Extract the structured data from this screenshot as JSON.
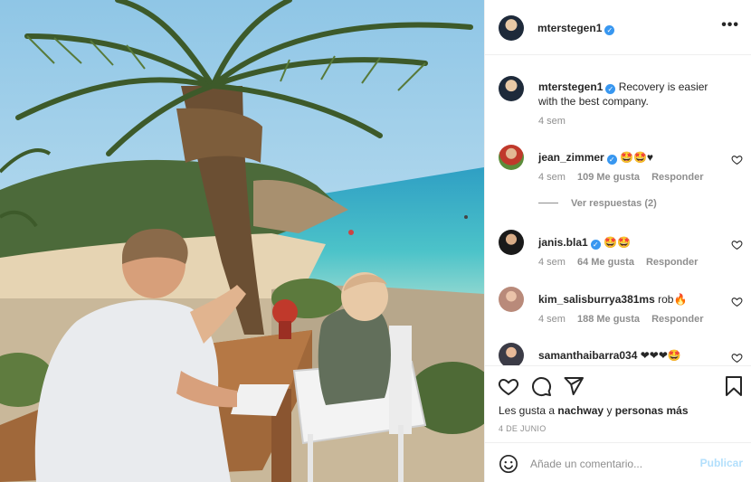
{
  "post": {
    "author": "mterstegen1",
    "caption": "Recovery is easier with the best company.",
    "caption_time": "4 sem",
    "more_label": "•••"
  },
  "comments": [
    {
      "user": "jean_zimmer",
      "verified": true,
      "text": "🤩🤩♥",
      "time": "4 sem",
      "likes": "109 Me gusta",
      "reply": "Responder",
      "view_replies": "Ver respuestas (2)"
    },
    {
      "user": "janis.bla1",
      "verified": true,
      "text": "🤩🤩",
      "time": "4 sem",
      "likes": "64 Me gusta",
      "reply": "Responder"
    },
    {
      "user": "kim_salisburrya381ms",
      "verified": false,
      "text": "rob🔥",
      "time": "4 sem",
      "likes": "188 Me gusta",
      "reply": "Responder"
    },
    {
      "user": "samanthaibarra034",
      "verified": false,
      "text": "❤❤❤🤩"
    }
  ],
  "likes_line": {
    "prefix": "Les gusta a",
    "user": "nachway",
    "joiner": "y",
    "others": "personas más"
  },
  "date": "4 DE JUNIO",
  "compose": {
    "placeholder": "Añade un comentario...",
    "publish": "Publicar"
  },
  "icons": [
    "heart-icon",
    "comment-icon",
    "share-icon",
    "bookmark-icon",
    "emoji-icon",
    "verified-badge",
    "more-options-icon"
  ],
  "colors": {
    "verified": "#3897f0",
    "publish_disabled": "#b2dffc",
    "muted": "#8e8e8e",
    "text": "#262626"
  }
}
